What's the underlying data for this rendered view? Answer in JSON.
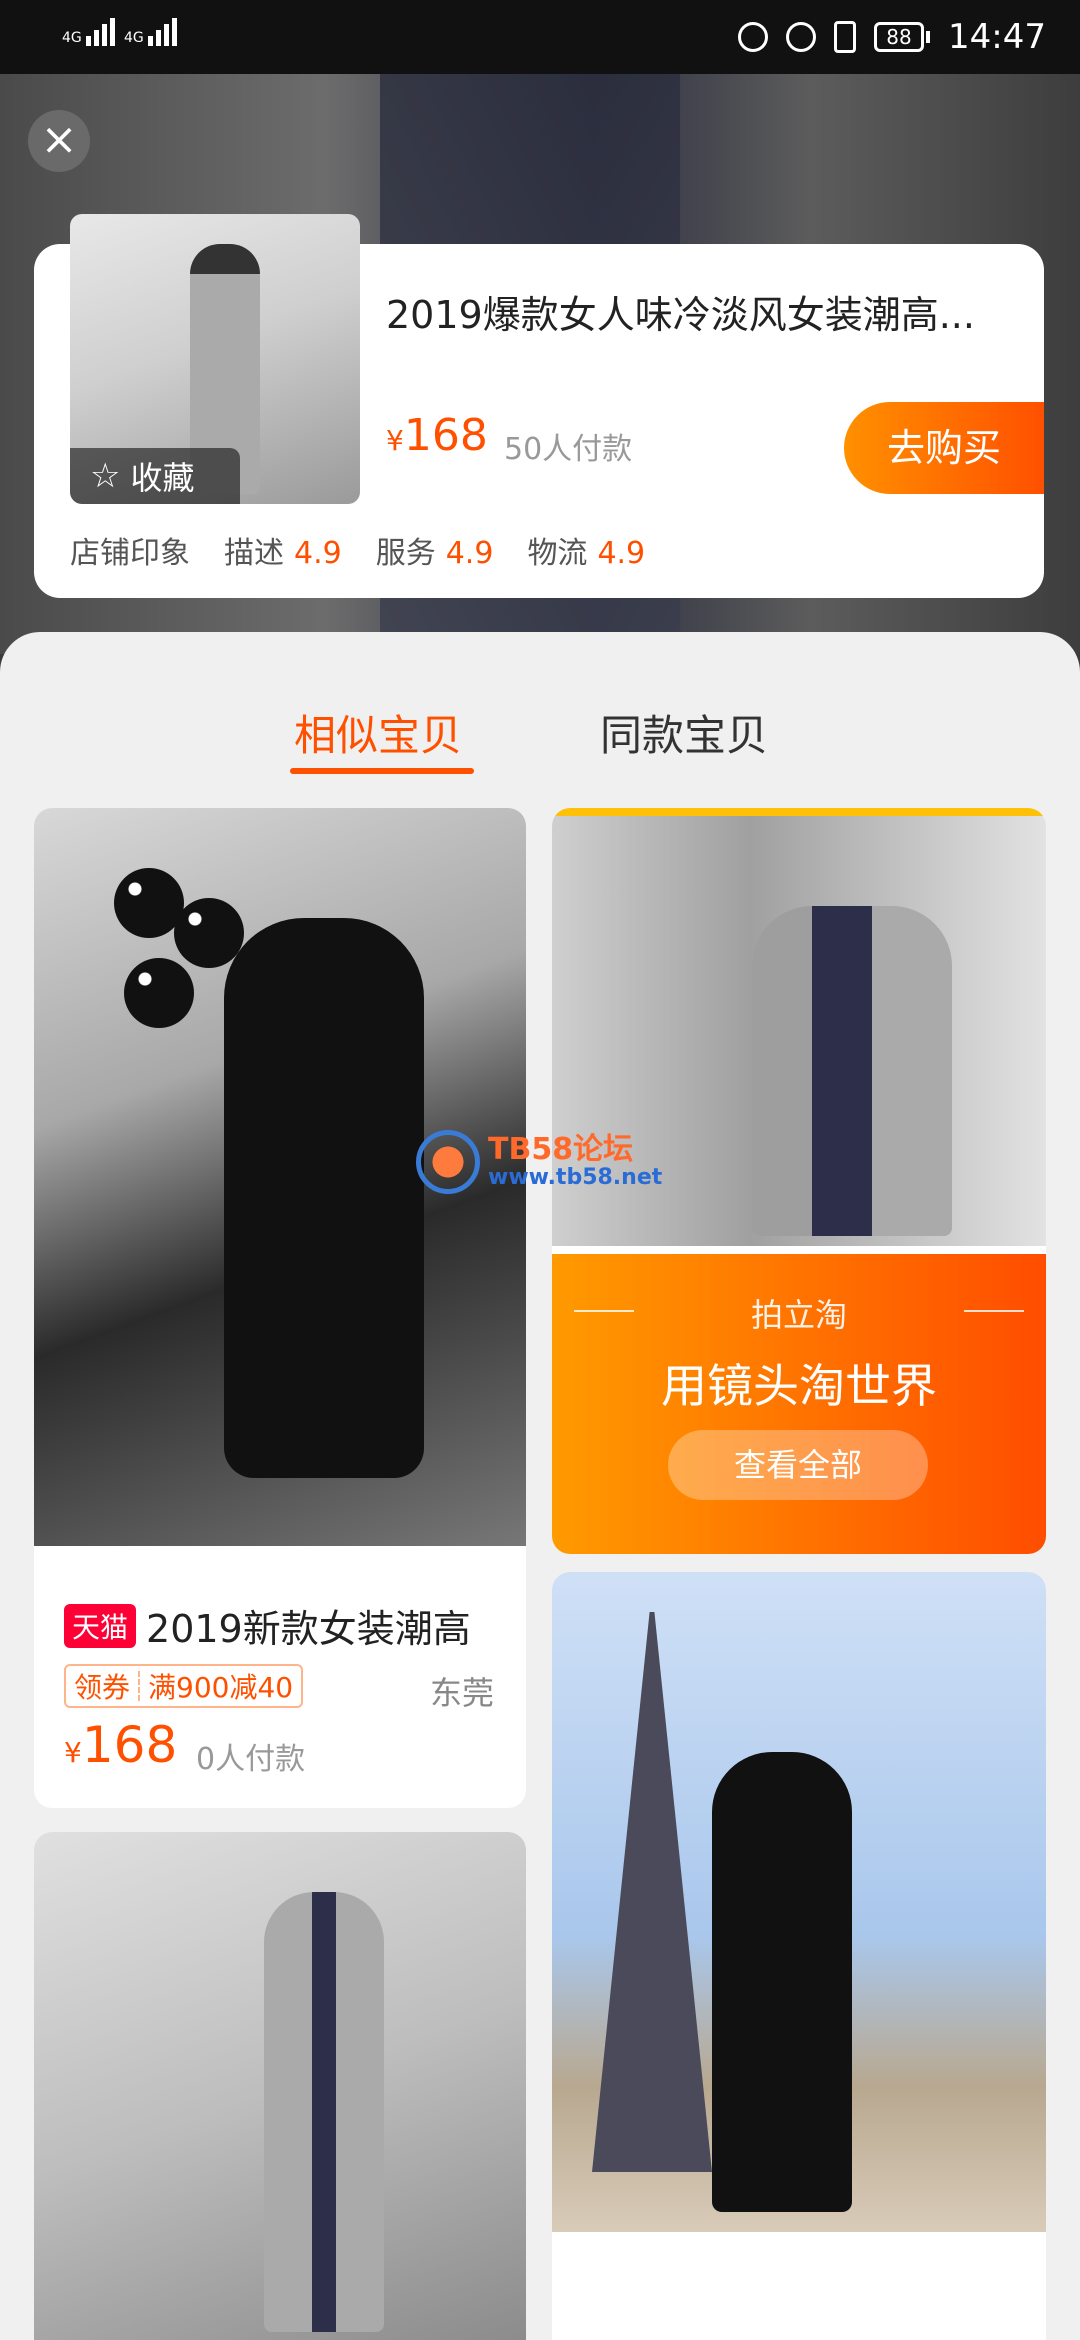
{
  "status_bar": {
    "signal_1": "4G",
    "signal_2": "4G",
    "battery": "88",
    "time": "14:47"
  },
  "product": {
    "favorite_label": "收藏",
    "title": "2019爆款女人味冷淡风女装潮高...",
    "currency": "¥",
    "price": "168",
    "sold": "50人付款",
    "buy_label": "去购买",
    "shop_label": "店铺印象",
    "ratings": [
      {
        "label": "描述",
        "score": "4.9"
      },
      {
        "label": "服务",
        "score": "4.9"
      },
      {
        "label": "物流",
        "score": "4.9"
      }
    ]
  },
  "tabs": [
    {
      "label": "相似宝贝",
      "active": true
    },
    {
      "label": "同款宝贝",
      "active": false
    }
  ],
  "items": [
    {
      "badge": "天猫",
      "title": "2019新款女装潮高",
      "coupon_label": "领券",
      "coupon_value": "满900减40",
      "city": "东莞",
      "currency": "¥",
      "price": "168",
      "sold": "0人付款"
    }
  ],
  "promo": {
    "subtitle": "拍立淘",
    "title": "用镜头淘世界",
    "button": "查看全部"
  },
  "watermark": {
    "name": "TB58论坛",
    "url": "www.tb58.net"
  },
  "colors": {
    "accent": "#ff5000",
    "tmall": "#ff0036"
  }
}
